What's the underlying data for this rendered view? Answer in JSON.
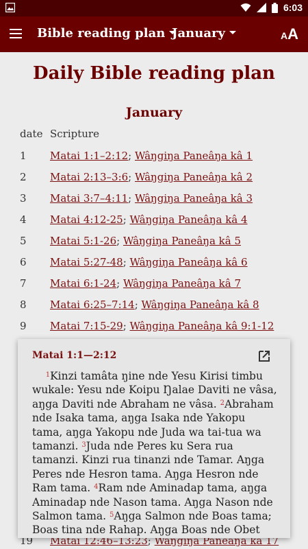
{
  "status_bar": {
    "time": "6:03"
  },
  "app_bar": {
    "plan_dropdown": "Bible reading plan",
    "month_dropdown": "January",
    "font_button_small": "A",
    "font_button_big": "A"
  },
  "page": {
    "title": "Daily Bible reading plan",
    "month": "January",
    "col_date": "date",
    "col_scripture": "Scripture"
  },
  "rows": [
    {
      "day": "1",
      "ref1": "Matai 1:1–2:12",
      "ref2": "Wâŋgiŋa Paneâŋa kâ 1"
    },
    {
      "day": "2",
      "ref1": "Matai 2:13–3:6",
      "ref2": "Wâŋgiŋa Paneâŋa kâ 2"
    },
    {
      "day": "3",
      "ref1": "Matai 3:7–4:11",
      "ref2": "Wâŋgiŋa Paneâŋa kâ 3"
    },
    {
      "day": "4",
      "ref1": "Matai 4:12-25",
      "ref2": "Wâŋgiŋa Paneâŋa kâ 4"
    },
    {
      "day": "5",
      "ref1": "Matai 5:1-26",
      "ref2": "Wâŋgiŋa Paneâŋa kâ 5"
    },
    {
      "day": "6",
      "ref1": "Matai 5:27-48",
      "ref2": "Wâŋgiŋa Paneâŋa kâ 6"
    },
    {
      "day": "7",
      "ref1": "Matai 6:1-24",
      "ref2": "Wâŋgiŋa Paneâŋa kâ 7"
    },
    {
      "day": "8",
      "ref1": "Matai 6:25–7:14",
      "ref2": "Wâŋgiŋa Paneâŋa kâ 8"
    },
    {
      "day": "9",
      "ref1": "Matai 7:15-29",
      "ref2": "Wâŋgiŋa Paneâŋa kâ 9:1-12"
    },
    {
      "day": "19",
      "ref1": "Matai 12:46–13:23",
      "ref2": "Wâŋgiŋa Paneâŋa kâ 17"
    }
  ],
  "popup": {
    "title": "Matai 1:1—2:12",
    "verses": [
      {
        "n": "1",
        "text": "Kinzi tamâta ŋine nde Yesu Kirisi timbu wukale: Yesu nde Koipu Ŋalae Daviti ne vâsa, aŋga Daviti nde Abraham ne vâsa."
      },
      {
        "n": "2",
        "text": "Abraham nde Isaka tama, aŋga Isaka nde Yakopu tama, aŋga Yakopu nde Juda wa tai-tua wa tamanzi."
      },
      {
        "n": "3",
        "text": "Juda nde Peres ku Sera rua tamanzi. Kinzi rua tinanzi nde Tamar. Aŋga Peres nde Hesron tama. Aŋga Hesron nde Ram tama."
      },
      {
        "n": "4",
        "text": "Ram nde Aminadap tama, aŋga Aminadap nde Nason tama. Aŋga Nason nde Salmon tama."
      },
      {
        "n": "5",
        "text": "Aŋga Salmon nde Boas tama; Boas tina nde Rahap. Aŋga Boas nde Obet tama, aŋga Obet tina nde"
      }
    ]
  }
}
